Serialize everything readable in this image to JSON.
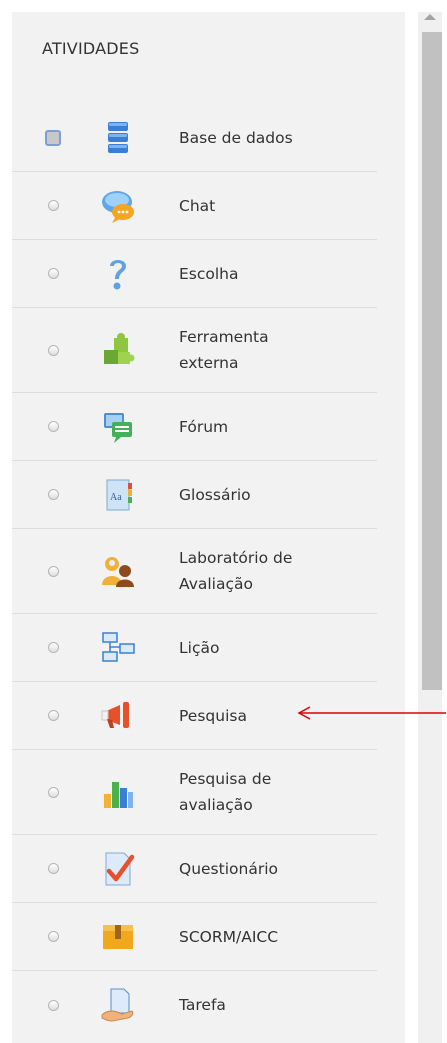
{
  "section": {
    "title": "ATIVIDADES"
  },
  "activities": [
    {
      "label_lines": [
        "Base de dados"
      ],
      "icon": "database-icon",
      "selected": true
    },
    {
      "label_lines": [
        "Chat"
      ],
      "icon": "chat-icon",
      "selected": false
    },
    {
      "label_lines": [
        "Escolha"
      ],
      "icon": "question-mark-icon",
      "selected": false
    },
    {
      "label_lines": [
        "Ferramenta",
        "externa"
      ],
      "icon": "puzzle-icon",
      "selected": false
    },
    {
      "label_lines": [
        "Fórum"
      ],
      "icon": "forum-icon",
      "selected": false
    },
    {
      "label_lines": [
        "Glossário"
      ],
      "icon": "glossary-icon",
      "selected": false
    },
    {
      "label_lines": [
        "Laboratório de",
        "Avaliação"
      ],
      "icon": "workshop-people-icon",
      "selected": false
    },
    {
      "label_lines": [
        "Lição"
      ],
      "icon": "lesson-flow-icon",
      "selected": false
    },
    {
      "label_lines": [
        "Pesquisa"
      ],
      "icon": "megaphone-icon",
      "selected": false
    },
    {
      "label_lines": [
        "Pesquisa de",
        "avaliação"
      ],
      "icon": "bar-chart-icon",
      "selected": false
    },
    {
      "label_lines": [
        "Questionário"
      ],
      "icon": "quiz-check-icon",
      "selected": false
    },
    {
      "label_lines": [
        "SCORM/AICC"
      ],
      "icon": "package-icon",
      "selected": false
    },
    {
      "label_lines": [
        "Tarefa"
      ],
      "icon": "assignment-hand-icon",
      "selected": false
    }
  ],
  "annotation": {
    "color": "#e00000",
    "icon": "red-arrow-left-icon"
  }
}
